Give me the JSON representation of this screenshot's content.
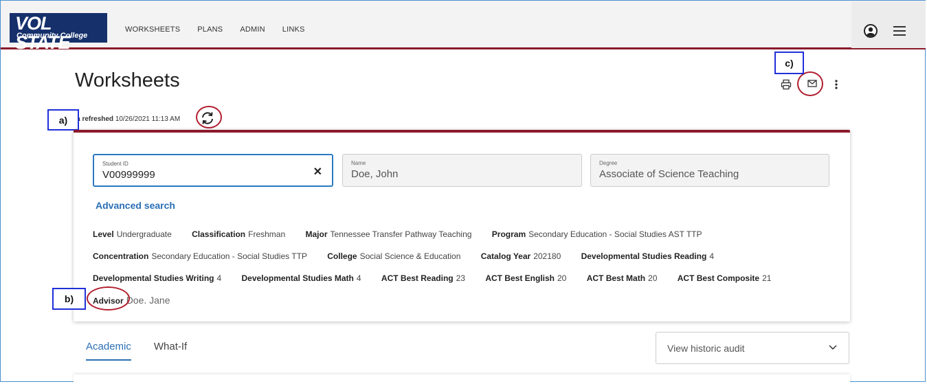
{
  "header": {
    "logo_main": "VOL STATE",
    "logo_sub": "Community College",
    "nav": [
      "WORKSHEETS",
      "PLANS",
      "ADMIN",
      "LINKS"
    ]
  },
  "page": {
    "title": "Worksheets",
    "refresh_label": "Data refreshed",
    "refresh_time": "10/26/2021 11:13 AM"
  },
  "callouts": {
    "a": "a)",
    "b": "b)",
    "c": "c)"
  },
  "search": {
    "student_id_label": "Student ID",
    "student_id_value": "V00999999",
    "name_label": "Name",
    "name_value": "Doe, John",
    "degree_label": "Degree",
    "degree_value": "Associate of Science Teaching",
    "advanced_search": "Advanced search"
  },
  "attributes": {
    "row1": [
      {
        "k": "Level",
        "v": "Undergraduate"
      },
      {
        "k": "Classification",
        "v": "Freshman"
      },
      {
        "k": "Major",
        "v": "Tennessee Transfer Pathway Teaching"
      },
      {
        "k": "Program",
        "v": "Secondary Education - Social Studies AST TTP"
      }
    ],
    "row2": [
      {
        "k": "Concentration",
        "v": "Secondary Education - Social Studies TTP"
      },
      {
        "k": "College",
        "v": "Social Science & Education"
      },
      {
        "k": "Catalog Year",
        "v": "202180"
      },
      {
        "k": "Developmental Studies Reading",
        "v": "4"
      }
    ],
    "row3": [
      {
        "k": "Developmental Studies Writing",
        "v": "4"
      },
      {
        "k": "Developmental Studies Math",
        "v": "4"
      },
      {
        "k": "ACT Best Reading",
        "v": "23"
      },
      {
        "k": "ACT Best English",
        "v": "20"
      },
      {
        "k": "ACT Best Math",
        "v": "20"
      },
      {
        "k": "ACT Best Composite",
        "v": "21"
      }
    ],
    "advisor_label": "Advisor",
    "advisor_value": "Doe. Jane"
  },
  "tabs": [
    {
      "label": "Academic",
      "active": true
    },
    {
      "label": "What-If",
      "active": false
    }
  ],
  "historic_audit": {
    "selected": "View historic audit"
  },
  "colors": {
    "accent": "#8b1a2b",
    "link": "#2a6fb5",
    "logo_bg": "#15306b",
    "annotation": "#b01e2e",
    "callout_border": "#1f2fd8"
  }
}
